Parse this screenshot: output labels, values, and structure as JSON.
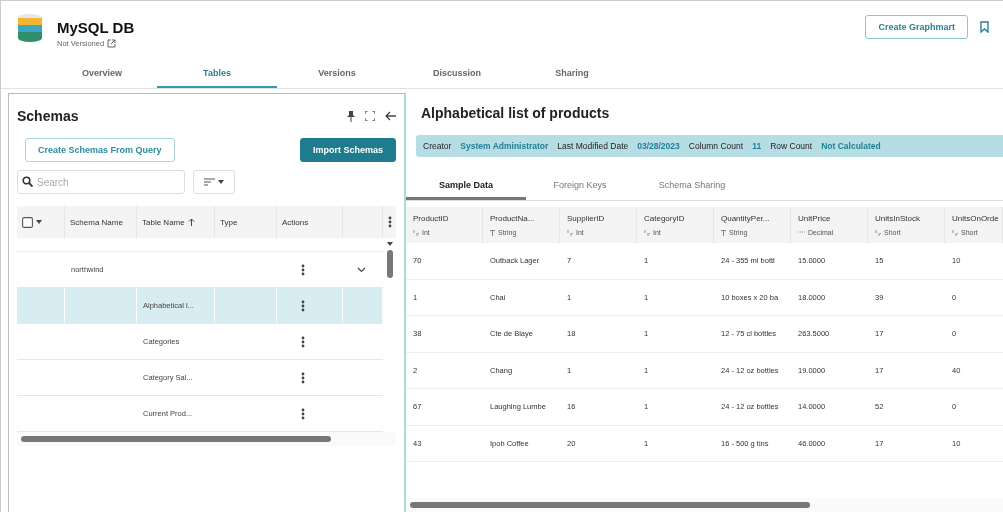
{
  "header": {
    "title": "MySQL DB",
    "subtitle": "Not Versioned",
    "action": "Create Graphmart"
  },
  "tabs": [
    {
      "label": "Overview",
      "selected": false
    },
    {
      "label": "Tables",
      "selected": true
    },
    {
      "label": "Versions",
      "selected": false
    },
    {
      "label": "Discussion",
      "selected": false
    },
    {
      "label": "Sharing",
      "selected": false
    }
  ],
  "schemas_panel": {
    "title": "Schemas",
    "buttons": [
      {
        "label": "Create Schemas From Query",
        "kind": "outline"
      },
      {
        "label": "Import Schemas",
        "kind": "primary"
      }
    ],
    "search": {
      "placeholder": "Search"
    },
    "table": {
      "select_all": {
        "checked": false
      },
      "columns": [
        {
          "label": "Schema Name",
          "sorted": false
        },
        {
          "label": "Table Name",
          "sorted": true
        },
        {
          "label": "Type",
          "sorted": false
        },
        {
          "label": "Actions",
          "sorted": false
        }
      ],
      "rows": [
        {
          "schema": "northwind",
          "table": "",
          "expandable": true,
          "selected": false
        },
        {
          "schema": "",
          "table": "Alphabetical l...",
          "expandable": false,
          "selected": true
        },
        {
          "schema": "",
          "table": "Categories",
          "expandable": false,
          "selected": false
        },
        {
          "schema": "",
          "table": "Category Sal...",
          "expandable": false,
          "selected": false
        },
        {
          "schema": "",
          "table": "Current Prod...",
          "expandable": false,
          "selected": false
        }
      ]
    }
  },
  "detail": {
    "title": "Alphabetical list of products",
    "info": [
      {
        "label": "Creator",
        "value": "System Administrator"
      },
      {
        "label": "Last Modified Date",
        "value": "03/28/2023"
      },
      {
        "label": "Column Count",
        "value": "11"
      },
      {
        "label": "Row Count",
        "value": "Not Calculated"
      }
    ],
    "tabs": [
      {
        "label": "Sample Data",
        "selected": true
      },
      {
        "label": "Foreign Keys",
        "selected": false
      },
      {
        "label": "Schema Sharing",
        "selected": false
      }
    ],
    "table": {
      "columns": [
        {
          "label": "ProductID",
          "type": "Int",
          "kind": "integer"
        },
        {
          "label": "ProductNa...",
          "type": "String",
          "kind": "text"
        },
        {
          "label": "SupplierID",
          "type": "Int",
          "kind": "integer"
        },
        {
          "label": "CategoryID",
          "type": "Int",
          "kind": "integer"
        },
        {
          "label": "QuantityPer...",
          "type": "String",
          "kind": "text"
        },
        {
          "label": "UnitPrice",
          "type": "Decimal",
          "kind": "decimal"
        },
        {
          "label": "UnitsInStock",
          "type": "Short",
          "kind": "integer"
        },
        {
          "label": "UnitsOnOrde",
          "type": "Short",
          "kind": "integer"
        }
      ],
      "rows": [
        [
          "70",
          "Outback Lager",
          "7",
          "1",
          "24 - 355 ml bottl",
          "15.0000",
          "15",
          "10"
        ],
        [
          "1",
          "Chai",
          "1",
          "1",
          "10 boxes x 20 ba",
          "18.0000",
          "39",
          "0"
        ],
        [
          "38",
          "Cte de Blaye",
          "18",
          "1",
          "12 - 75 cl bottles",
          "263.5000",
          "17",
          "0"
        ],
        [
          "2",
          "Chang",
          "1",
          "1",
          "24 - 12 oz bottles",
          "19.0000",
          "17",
          "40"
        ],
        [
          "67",
          "Laughing Lumbe",
          "16",
          "1",
          "24 - 12 oz bottles",
          "14.0000",
          "52",
          "0"
        ],
        [
          "43",
          "Ipoh Coffee",
          "20",
          "1",
          "16 - 500 g tins",
          "46.0000",
          "17",
          "10"
        ]
      ]
    }
  }
}
